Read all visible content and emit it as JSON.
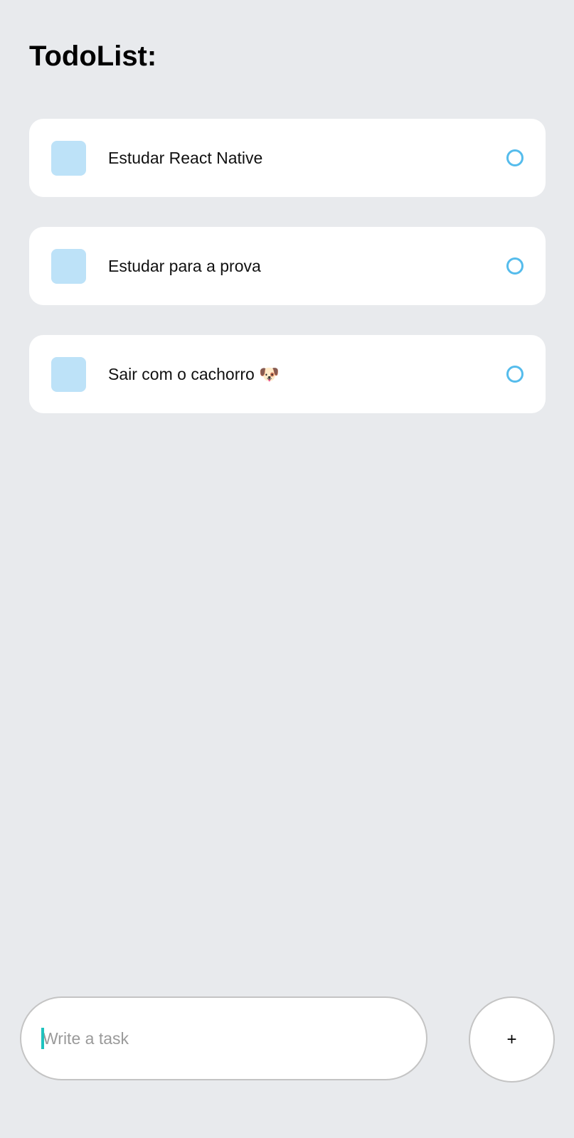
{
  "header": {
    "title": "TodoList:"
  },
  "tasks": [
    {
      "text": "Estudar React Native"
    },
    {
      "text": "Estudar para a prova"
    },
    {
      "text": "Sair com o cachorro 🐶"
    }
  ],
  "composer": {
    "placeholder": "Write a task",
    "value": "",
    "add_label": "+"
  },
  "colors": {
    "background": "#E8EAED",
    "card": "#FFFFFF",
    "square": "#BDE2F8",
    "circle": "#55BCEC",
    "caret": "#1FC2BE"
  }
}
